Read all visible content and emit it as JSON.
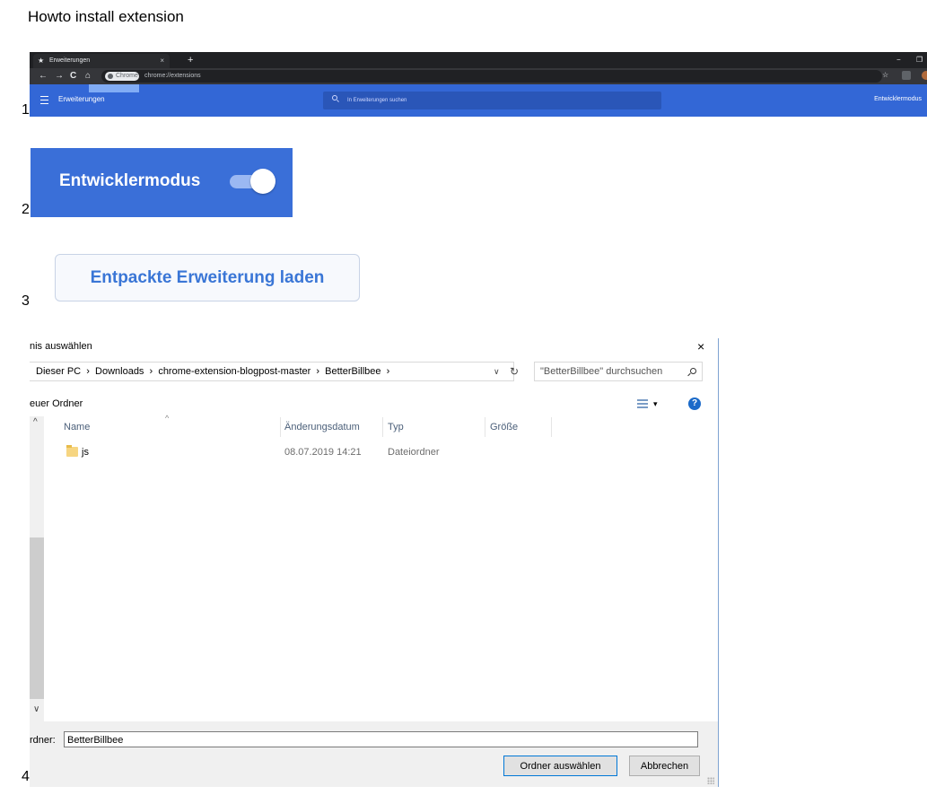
{
  "doc": {
    "title": "Howto install extension"
  },
  "steps": [
    "1",
    "2",
    "3",
    "4"
  ],
  "chrome": {
    "tab_title": "Erweiterungen",
    "tab_close": "×",
    "new_tab": "+",
    "minimize": "−",
    "restore": "❐",
    "back": "←",
    "forward": "→",
    "reload": "C",
    "home": "⌂",
    "site_label": "Chrome",
    "url": "chrome://extensions",
    "bookmark_star": "☆",
    "page_title": "Erweiterungen",
    "search_placeholder": "In Erweiterungen suchen",
    "dev_mode_label": "Entwicklermodus",
    "colors": {
      "tabbar": "#202124",
      "toolbar": "#35363a",
      "header": "#3367d6"
    }
  },
  "dev_toggle": {
    "label": "Entwicklermodus",
    "on": true
  },
  "load_button": {
    "label": "Entpackte Erweiterung laden"
  },
  "dialog": {
    "title_partial": "nis auswählen",
    "close": "×",
    "address": "Dieser PC  ›  Downloads  ›  chrome-extension-blogpost-master  ›  BetterBillbee  ›",
    "address_dropdown": "∨",
    "refresh": "↻",
    "search_placeholder": "\"BetterBillbee\" durchsuchen",
    "new_folder_partial": "euer Ordner",
    "view_caret": "▾",
    "help": "?",
    "scroll_up": "^",
    "scroll_down": "∨",
    "sort_caret": "^",
    "columns": [
      "Name",
      "Änderungsdatum",
      "Typ",
      "Größe"
    ],
    "rows": [
      {
        "name": "js",
        "date": "08.07.2019 14:21",
        "type": "Dateiordner",
        "size": ""
      }
    ],
    "folder_label_partial": "rdner:",
    "folder_value": "BetterBillbee",
    "select_button": "Ordner auswählen",
    "cancel_button": "Abbrechen"
  }
}
